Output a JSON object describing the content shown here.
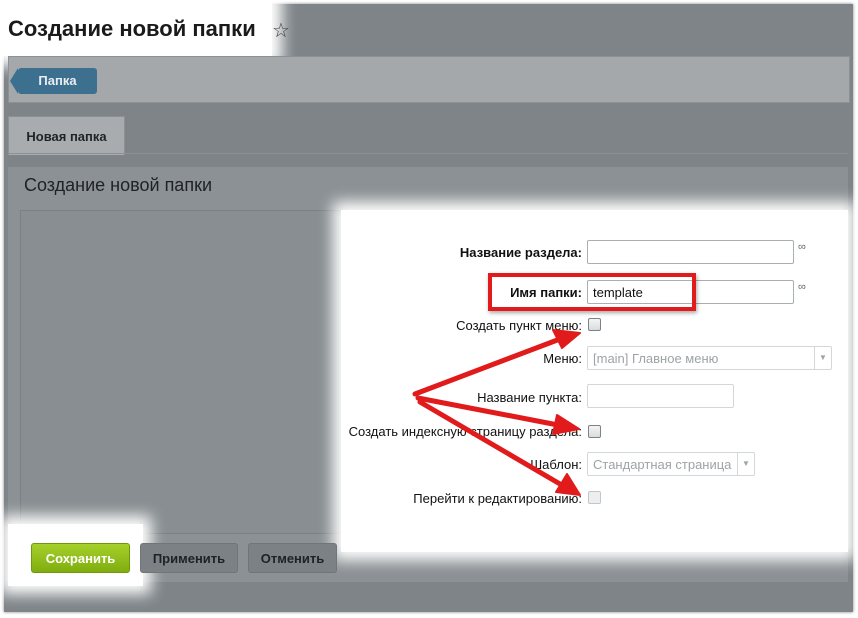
{
  "page": {
    "title": "Создание новой папки"
  },
  "toolbar": {
    "back_label": "Папка"
  },
  "tabs": [
    {
      "label": "Новая папка"
    }
  ],
  "form": {
    "heading": "Создание новой папки",
    "section_name": {
      "label": "Название раздела:",
      "value": ""
    },
    "folder_name": {
      "label": "Имя папки:",
      "value": "template"
    },
    "create_menu_item": {
      "label": "Создать пункт меню:",
      "checked": false
    },
    "menu": {
      "label": "Меню:",
      "value": "[main] Главное меню"
    },
    "item_name": {
      "label": "Название пункта:",
      "value": ""
    },
    "create_index": {
      "label": "Создать индексную страницу раздела:",
      "checked": false
    },
    "template": {
      "label": "Шаблон:",
      "value": "Стандартная страница"
    },
    "go_edit": {
      "label": "Перейти к редактированию:",
      "checked": false
    }
  },
  "buttons": {
    "save": "Сохранить",
    "apply": "Применить",
    "cancel": "Отменить"
  },
  "colors": {
    "annotation_red": "#e11b1b",
    "save_green": "#8cbc16",
    "back_blue": "#3d6f8f"
  }
}
